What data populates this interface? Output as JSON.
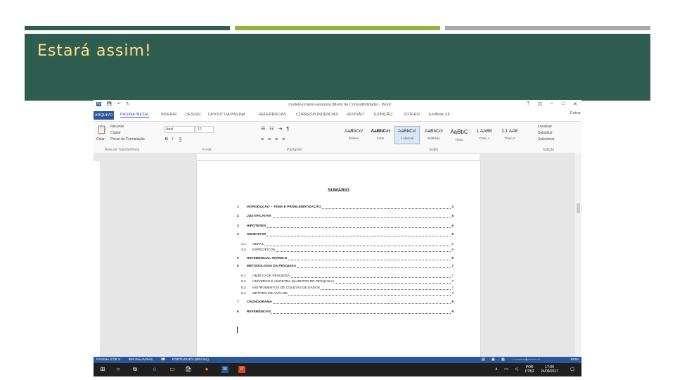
{
  "slide": {
    "title": "Estará assim!"
  },
  "colors": {
    "banner": "#2f5e51",
    "title_text": "#ffe28a",
    "accent_green": "#8db63b",
    "accent_gray": "#a6a8ab",
    "word_blue": "#2b579a"
  },
  "word": {
    "window_title": "modelo-projeto-pesquisa [Modo de Compatibilidade] - Word",
    "window_controls": [
      "?",
      "⊡",
      "–",
      "□",
      "✕"
    ],
    "quick_access": [
      "save-icon",
      "undo-icon",
      "redo-icon"
    ],
    "user": "Entrar",
    "tabs": [
      "ARQUIVO",
      "PÁGINA INICIAL",
      "INSERIR",
      "DESIGN",
      "LAYOUT DA PÁGINA",
      "REFERÊNCIAS",
      "CORRESPONDÊNCIAS",
      "REVISÃO",
      "EXIBIÇÃO",
      "ZOTERO",
      "EndNote X5"
    ],
    "ribbon": {
      "clipboard": {
        "paste": "Colar",
        "cut": "Recortar",
        "copy": "Copiar",
        "format_painter": "Pincel de Formatação",
        "label": "Área de Transferência"
      },
      "font": {
        "name": "Arial",
        "size": "12",
        "label": "Fonte",
        "buttons": [
          "N",
          "I",
          "S"
        ]
      },
      "paragraph": {
        "label": "Parágrafo"
      },
      "styles": {
        "label": "Estilo",
        "items": [
          {
            "preview": "AaBbCcI",
            "name": "Ênfase"
          },
          {
            "preview": "AaBbCcI",
            "name": "Forte"
          },
          {
            "preview": "AaBbCcI",
            "name": "1 Normal"
          },
          {
            "preview": "AaBbCcI",
            "name": "Subtítulo"
          },
          {
            "preview": "AaBbC",
            "name": "Título"
          },
          {
            "preview": "1 AABE",
            "name": "Título 1"
          },
          {
            "preview": "1.1 AAE",
            "name": "Título 2"
          }
        ]
      },
      "editing": {
        "label": "Edição",
        "find": "Localizar",
        "replace": "Substituir",
        "select": "Selecionar"
      }
    },
    "document": {
      "heading": "SUMÁRIO",
      "toc": [
        {
          "num": "1",
          "label": "INTRODUÇÃO – TEMA E PROBLEMATIZAÇÃO",
          "page": "4",
          "level": 1
        },
        {
          "num": "2",
          "label": "JUSTIFICATIVA",
          "page": "5",
          "level": 1
        },
        {
          "num": "3",
          "label": "HIPÓTESES",
          "page": "5",
          "level": 1
        },
        {
          "num": "4",
          "label": "OBJETIVOS",
          "page": "6",
          "level": 1
        },
        {
          "num": "4.1",
          "label": "GERAL",
          "page": "6",
          "level": 2
        },
        {
          "num": "4.2",
          "label": "ESPECÍFICOS",
          "page": "6",
          "level": 2
        },
        {
          "num": "5",
          "label": "REFERENCIAL TEÓRICO",
          "page": "6",
          "level": 1
        },
        {
          "num": "6",
          "label": "METODOLOGIA DA PESQUISA",
          "page": "7",
          "level": 1
        },
        {
          "num": "6.1",
          "label": "OBJETO DE PESQUISA",
          "page": "7",
          "level": 2
        },
        {
          "num": "6.2",
          "label": "UNIVERSO E AMOSTRA (SUJEITOS DE PESQUISA)",
          "page": "7",
          "level": 2
        },
        {
          "num": "6.3",
          "label": "INSTRUMENTOS DE COLETAS DE DADOS",
          "page": "7",
          "level": 2
        },
        {
          "num": "6.4",
          "label": "MÉTODO DE ANÁLISE",
          "page": "7",
          "level": 2
        },
        {
          "num": "7",
          "label": "CRONOGRAMA",
          "page": "8",
          "level": 1
        },
        {
          "num": "8",
          "label": "REFERÊNCIAS",
          "page": "9",
          "level": 1
        }
      ]
    },
    "status": {
      "page": "PÁGINA 3 DE 9",
      "words": "808 PALAVRAS",
      "language": "PORTUGUÊS (BRASIL)",
      "zoom": "100%"
    }
  },
  "taskbar": {
    "icons": [
      "windows-icon",
      "search-icon",
      "task-view-icon",
      "edge-icon",
      "explorer-icon",
      "store-icon",
      "firefox-icon",
      "word-icon",
      "powerpoint-icon"
    ],
    "lang": "POR",
    "layout": "PTB2",
    "time": "17:09",
    "date": "24/09/2017"
  }
}
